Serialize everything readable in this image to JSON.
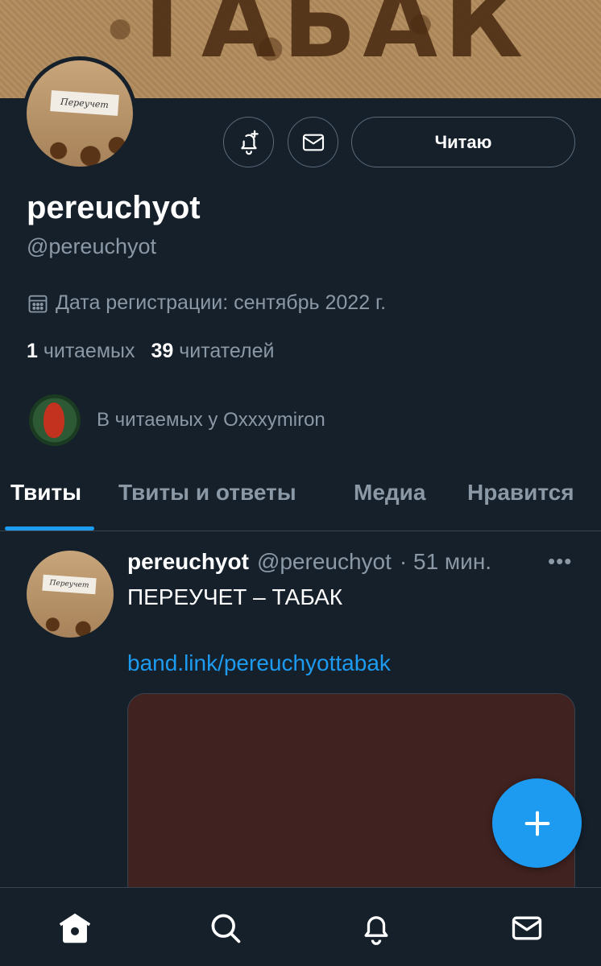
{
  "banner": {
    "text": "ТАБАК"
  },
  "profile": {
    "avatar_text": "Переучет",
    "name": "pereuchyot",
    "handle": "@pereuchyot",
    "joined": "Дата регистрации: сентябрь 2022 г.",
    "following_count": "1",
    "following_label": "читаемых",
    "followers_count": "39",
    "followers_label": "читателей",
    "followed_by": "В читаемых у Oxxxymiron"
  },
  "actions": {
    "notify_icon": "bell-plus-icon",
    "message_icon": "mail-icon",
    "follow_label": "Читаю"
  },
  "tabs": [
    {
      "label": "Твиты",
      "active": true
    },
    {
      "label": "Твиты и ответы",
      "active": false
    },
    {
      "label": "Медиа",
      "active": false
    },
    {
      "label": "Нравится",
      "active": false
    }
  ],
  "tweet": {
    "name": "pereuchyot",
    "handle": "@pereuchyot",
    "time": "· 51 мин.",
    "more": "•••",
    "text": "ПЕРЕУЧЕТ – ТАБАК",
    "link": "band.link/pereuchyottabak"
  },
  "colors": {
    "accent": "#1d9bf0",
    "background": "#15202b",
    "muted": "#8b98a5",
    "border": "#38444d"
  },
  "nav": [
    "home-icon",
    "search-icon",
    "notifications-icon",
    "messages-icon"
  ]
}
